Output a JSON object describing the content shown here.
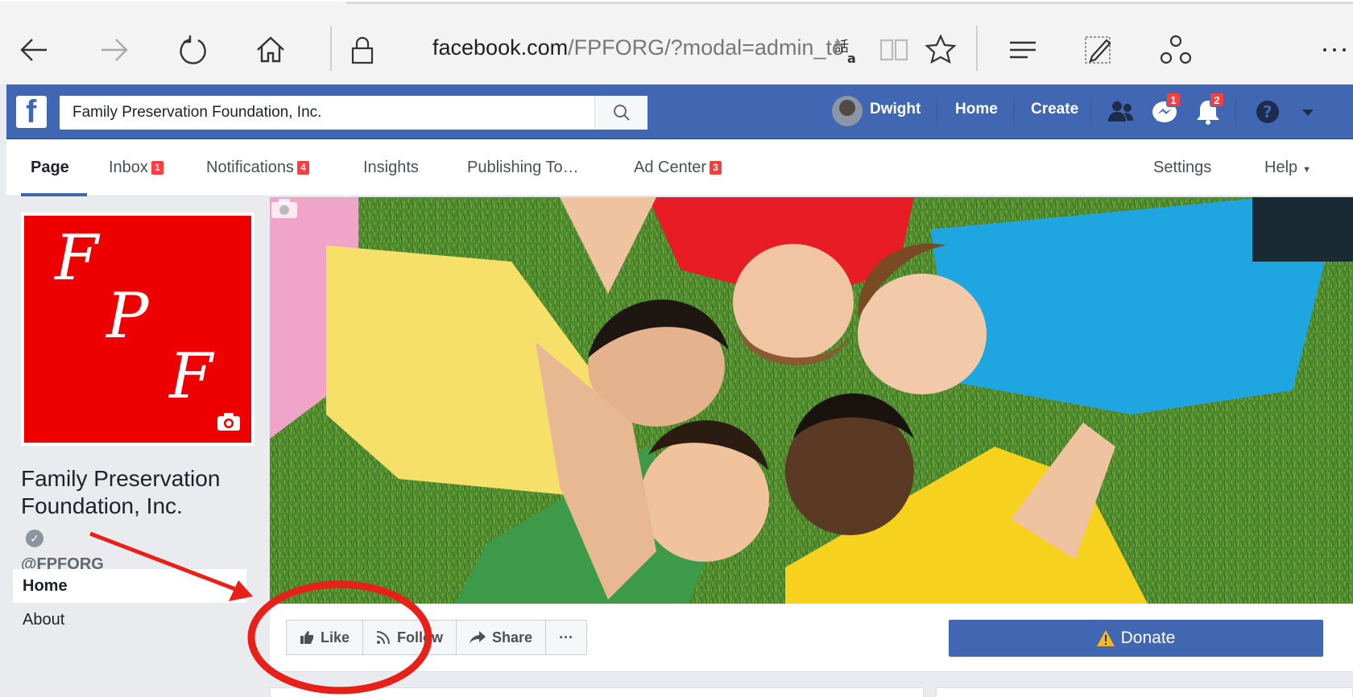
{
  "browser": {
    "url_host": "facebook.com",
    "url_path": "/FPFORG/?modal=admin_to",
    "icons": [
      "back-arrow-icon",
      "forward-arrow-icon",
      "refresh-icon",
      "home-icon",
      "lock-icon",
      "translate-icon",
      "reading-view-icon",
      "favorite-star-icon",
      "hub-icon",
      "web-note-icon",
      "share-icon",
      "more-icon"
    ]
  },
  "header": {
    "search_value": "Family Preservation Foundation, Inc.",
    "user_name": "Dwight",
    "home_label": "Home",
    "create_label": "Create",
    "messages_count": "1",
    "notifications_count": "2",
    "color": "#4267b2"
  },
  "page_nav": {
    "items": [
      {
        "label": "Page"
      },
      {
        "label": "Inbox",
        "badge": "1"
      },
      {
        "label": "Notifications",
        "badge": "4"
      },
      {
        "label": "Insights"
      },
      {
        "label": "Publishing To…"
      },
      {
        "label": "Ad Center",
        "badge": "3"
      },
      {
        "label": "Settings"
      },
      {
        "label": "Help"
      }
    ]
  },
  "profile": {
    "logo_letters": [
      "F",
      "P",
      "F"
    ],
    "title": "Family Preservation Foundation, Inc.",
    "handle": "@FPFORG",
    "logo_color": "#ee0000"
  },
  "side_menu": [
    {
      "label": "Home"
    },
    {
      "label": "About"
    }
  ],
  "actions": {
    "like": "Like",
    "follow": "Follow",
    "share": "Share",
    "more": "···",
    "donate": "Donate"
  },
  "annotation_color": "#e8201a"
}
